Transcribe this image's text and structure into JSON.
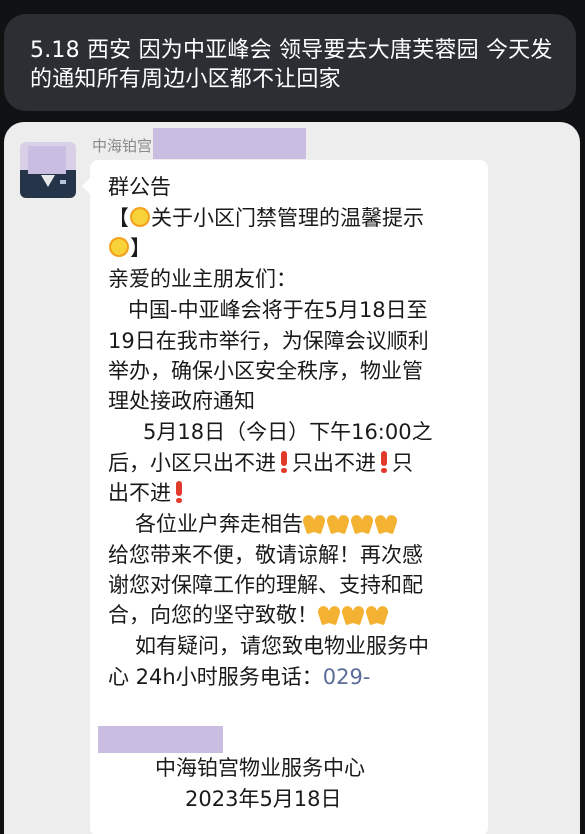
{
  "caption": {
    "line1": "5.18 西安 因为中亚峰会 领导要去大唐芙蓉园 今天发",
    "line2": "的通知所有周边小区都不让回家"
  },
  "chat": {
    "sender_name": "中海铂宫"
  },
  "message": {
    "title": "群公告",
    "notice_open": "【",
    "notice_text": "关于小区门禁管理的温馨提示",
    "notice_close": "】",
    "greeting": "亲爱的业主朋友们：",
    "p1_l1": "中国-中亚峰会将于在5月18日至",
    "p1_l2": "19日在我市举行，为保障会议顺利",
    "p1_l3": "举办，确保小区安全秩序，物业管",
    "p1_l4": "理处接政府通知",
    "p2_l1": "5月18日（今日）下午16:00之",
    "p2_l2a": "后，小区只出不进",
    "p2_l2b": "只出不进",
    "p2_l3": "出不进",
    "p3_l1": "各位业户奔走相告",
    "p3_l2": "给您带来不便，敬请谅解！再次感",
    "p3_l3": "谢您对保障工作的理解、支持和配",
    "p3_l4": "合，向您的坚守致敬！",
    "p4_l1": "如有疑问，请您致电物业服务中",
    "p4_l2": "心 24h小时服务电话：",
    "phone_prefix": "029-",
    "signature": "中海铂宫物业服务中心",
    "date": "2023年5月18日"
  },
  "icons": {
    "sun": "sun-emoji-icon",
    "exclamation": "red-exclamation-icon",
    "pray": "folded-hands-icon"
  },
  "colors": {
    "caption_bg": "#2b2e33",
    "chat_bg": "#ededed",
    "bubble_bg": "#ffffff",
    "redaction": "#c9bde2",
    "phone_link": "#5b6c99"
  }
}
